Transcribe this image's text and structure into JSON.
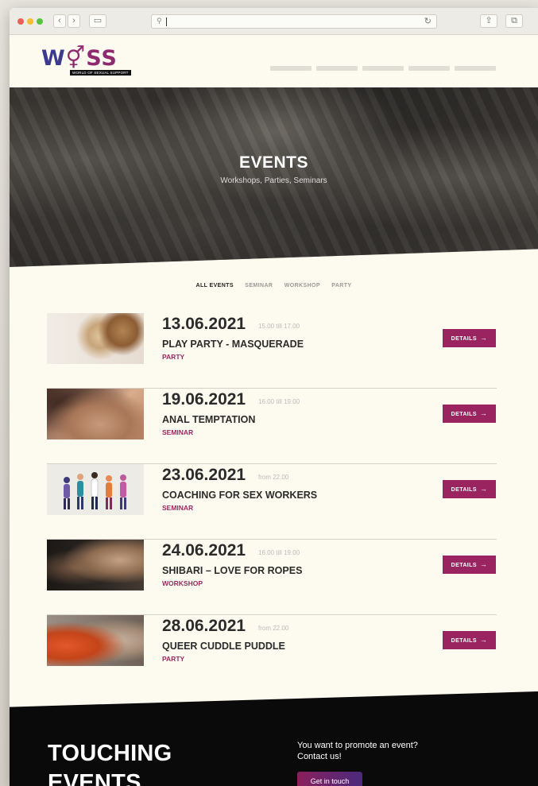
{
  "browser": {
    "url": "",
    "icons": {
      "back": "chevron-left-icon",
      "forward": "chevron-right-icon",
      "sidebar": "sidebar-icon",
      "search": "search-icon",
      "reload": "reload-icon",
      "share": "share-icon",
      "tabs": "tabs-icon"
    }
  },
  "header": {
    "logo_letters": "WOSS",
    "logo_tagline": "WORLD OF SEXUAL SUPPORT",
    "colors": {
      "logo_blue": "#3b3a8f",
      "logo_magenta": "#8f2a6f"
    }
  },
  "hero": {
    "title": "EVENTS",
    "subtitle": "Workshops, Parties, Seminars"
  },
  "filters": [
    {
      "label": "ALL EVENTS",
      "active": true
    },
    {
      "label": "SEMINAR",
      "active": false
    },
    {
      "label": "WORKSHOP",
      "active": false
    },
    {
      "label": "PARTY",
      "active": false
    }
  ],
  "events": [
    {
      "date": "13.06.2021",
      "time": "15.00 till 17.00",
      "title": "PLAY PARTY - MASQUERADE",
      "category": "PARTY",
      "button": "DETAILS"
    },
    {
      "date": "19.06.2021",
      "time": "16.00 till 19.00",
      "title": "ANAL TEMPTATION",
      "category": "SEMINAR",
      "button": "DETAILS"
    },
    {
      "date": "23.06.2021",
      "time": "from 22.00",
      "title": "COACHING FOR SEX WORKERS",
      "category": "SEMINAR",
      "button": "DETAILS"
    },
    {
      "date": "24.06.2021",
      "time": "16.00 till 19.00",
      "title": "SHIBARI – LOVE FOR ROPES",
      "category": "WORKSHOP",
      "button": "DETAILS"
    },
    {
      "date": "28.06.2021",
      "time": "from 22.00",
      "title": "QUEER CUDDLE PUDDLE",
      "category": "PARTY",
      "button": "DETAILS"
    }
  ],
  "footer": {
    "title_line1": "TOUCHING",
    "title_line2": "EVENTS",
    "promo_line1": "You want to promote an event?",
    "promo_line2": "Contact us!",
    "button": "Get in touch"
  },
  "colors": {
    "accent": "#99245f",
    "page_bg": "#fdfbef",
    "footer_bg": "#0b0a0a"
  }
}
